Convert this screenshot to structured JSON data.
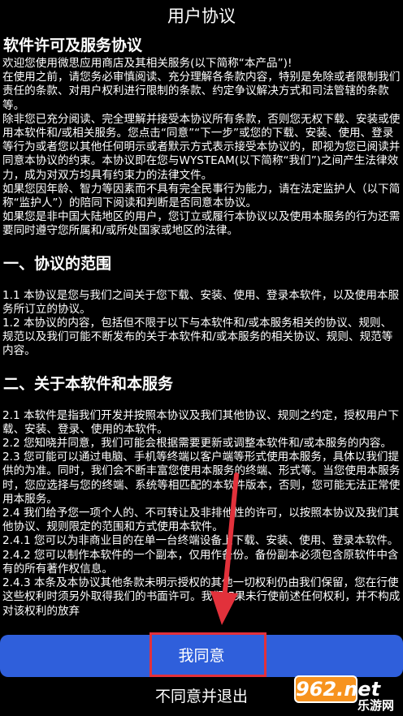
{
  "header": {
    "title": "用户协议"
  },
  "agreement": {
    "heading": "软件许可及服务协议",
    "intro": [
      "欢迎您使用微思应用商店及其相关服务(以下简称“本产品”)!",
      "在使用之前，请您务必审慎阅读、充分理解各条款内容，特别是免除或者限制我们责任的条款、对用户权利进行限制的条款、约定争议解决方式和司法管辖的条款等。",
      "除非您已充分阅读、完全理解并接受本协议所有条款，否则您无权下载、安装或使用本软件和/或相关服务。您点击“同意”“下一步”或您的下载、安装、使用、登录等行为或者您以其他任何明示或者默示方式表示接受本协议的，即视为您已阅读并同意本协议的约束。本协议即在您与WYSTEAM(以下简称“我们”)之间产生法律效力，成为对双方均具有约束力的法律文件。",
      "如果您因年龄、智力等因素而不具有完全民事行为能力，请在法定监护人（以下简称“监护人”）的陪同下阅读和判断是否同意本协议。",
      "如果您是非中国大陆地区的用户，您订立或履行本协议以及使用本服务的行为还需要同时遵守您所属和/或所处国家或地区的法律。"
    ],
    "section1": {
      "title": "一、协议的范围",
      "items": [
        "1.1 本协议是您与我们之间关于您下载、安装、使用、登录本软件，以及使用本服务所订立的协议。",
        "1.2 本协议的内容，包括但不限于以下与本软件和/或本服务相关的协议、规则、规范以及我们可能不断发布的关于本软件和/或本服务的相关协议、规则、规范等内容。"
      ]
    },
    "section2": {
      "title": "二、关于本软件和本服务",
      "items": [
        "2.1 本软件是指我们开发并按照本协议及我们其他协议、规则之约定，授权用户下载、安装、登录、使用的本软件。",
        "2.2 您知晓并同意，我们可能会根据需要更新或调整本软件和/或本服务的内容。",
        "2.3 您可能可以通过电脑、手机等终端以客户端等形式使用本服务，具体以我们提供的为准。同时，我们会不断丰富您使用本服务的终端、形式等。当您使用本服务时，您应选择与您的终端、系统等相匹配的本软件版本，否则，您可能无法正常使用本服务。",
        "2.4 我们给予您一项个人的、不可转让及非排他性的许可，以按照本协议及我们其他协议、规则限定的范围和方式使用本软件。",
        "2.4.1 您可以为非商业目的在单一台终端设备上下载、安装、使用、登录本软件。",
        "2.4.2 您可以制作本软件的一个副本，仅用作备份。备份副本必须包含原软件中含有的所有著作权信息。",
        "2.4.3 本条及本协议其他条款未明示授权的其他一切权利仍由我们保留，您在行使这些权利时须另外取得我们的书面许可。我们如果未行使前述任何权利，并不构成对该权利的放弃"
      ]
    }
  },
  "actions": {
    "agree_label": "我同意",
    "decline_label": "不同意并退出"
  },
  "watermark": {
    "domain": "962.net",
    "site": "乐游网"
  },
  "colors": {
    "background": "#000000",
    "agree_button": "#2f5fdb",
    "highlight": "#e2313b",
    "logo": "#f7931e"
  }
}
